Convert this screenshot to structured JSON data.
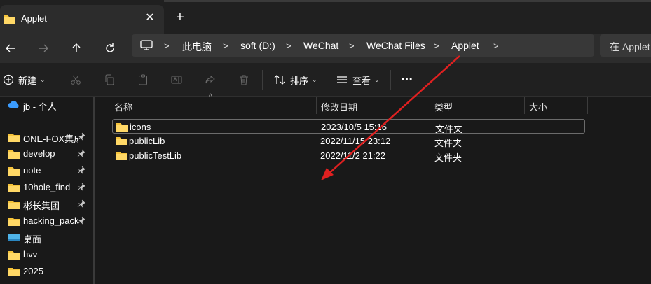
{
  "tab": {
    "title": "Applet",
    "close_glyph": "✕",
    "new_tab_glyph": "+"
  },
  "nav": {
    "back_icon": "arrow-left-icon",
    "forward_icon": "arrow-right-icon",
    "up_icon": "arrow-up-icon",
    "refresh_icon": "refresh-icon"
  },
  "breadcrumb": [
    {
      "label": "此电脑"
    },
    {
      "label": "soft (D:)"
    },
    {
      "label": "WeChat"
    },
    {
      "label": "WeChat Files"
    },
    {
      "label": "Applet"
    }
  ],
  "search": {
    "placeholder": "在 Applet"
  },
  "toolbar": {
    "new_label": "新建",
    "sort_label": "排序",
    "view_label": "查看",
    "more_glyph": "···"
  },
  "sidebar": {
    "items": [
      {
        "label": "jb - 个人",
        "icon": "onedrive-icon",
        "pinned": false
      },
      {
        "label": "ONE-FOX集成",
        "icon": "folder-icon",
        "pinned": true
      },
      {
        "label": "develop",
        "icon": "folder-icon",
        "pinned": true
      },
      {
        "label": "note",
        "icon": "folder-icon",
        "pinned": true
      },
      {
        "label": "10hole_find",
        "icon": "folder-icon",
        "pinned": true
      },
      {
        "label": "彬长集团",
        "icon": "folder-icon",
        "pinned": true
      },
      {
        "label": "hacking_pack",
        "icon": "folder-icon",
        "pinned": true
      },
      {
        "label": "桌面",
        "icon": "desktop-icon",
        "pinned": false
      },
      {
        "label": "hvv",
        "icon": "folder-icon",
        "pinned": false
      },
      {
        "label": "2025",
        "icon": "folder-icon",
        "pinned": false
      }
    ]
  },
  "columns": {
    "name": "名称",
    "modified": "修改日期",
    "type": "类型",
    "size": "大小"
  },
  "files": [
    {
      "name": "icons",
      "modified": "2023/10/5 15:16",
      "type": "文件夹",
      "selected": true
    },
    {
      "name": "publicLib",
      "modified": "2022/11/15 23:12",
      "type": "文件夹",
      "selected": false
    },
    {
      "name": "publicTestLib",
      "modified": "2022/11/2 21:22",
      "type": "文件夹",
      "selected": false
    }
  ],
  "colors": {
    "folder": "#f5c33b",
    "annotation_arrow": "#e02020",
    "background": "#191919"
  }
}
